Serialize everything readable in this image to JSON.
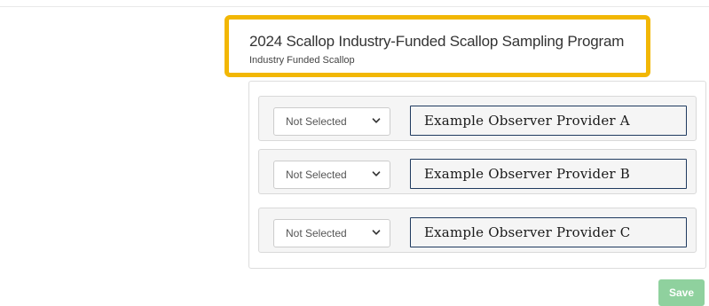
{
  "program": {
    "title": "2024 Scallop Industry-Funded Scallop Sampling Program",
    "subtitle": "Industry Funded Scallop"
  },
  "providers": [
    {
      "selection": "Not Selected",
      "name": "Example Observer Provider A"
    },
    {
      "selection": "Not Selected",
      "name": "Example Observer Provider B"
    },
    {
      "selection": "Not Selected",
      "name": "Example Observer Provider C"
    }
  ],
  "actions": {
    "save_label": "Save"
  },
  "icons": {
    "select_chevron": "chevron-down-icon"
  },
  "colors": {
    "highlight_border": "#f2b705",
    "provider_border": "#1f3a5f",
    "save_button": "#8fd19e"
  }
}
